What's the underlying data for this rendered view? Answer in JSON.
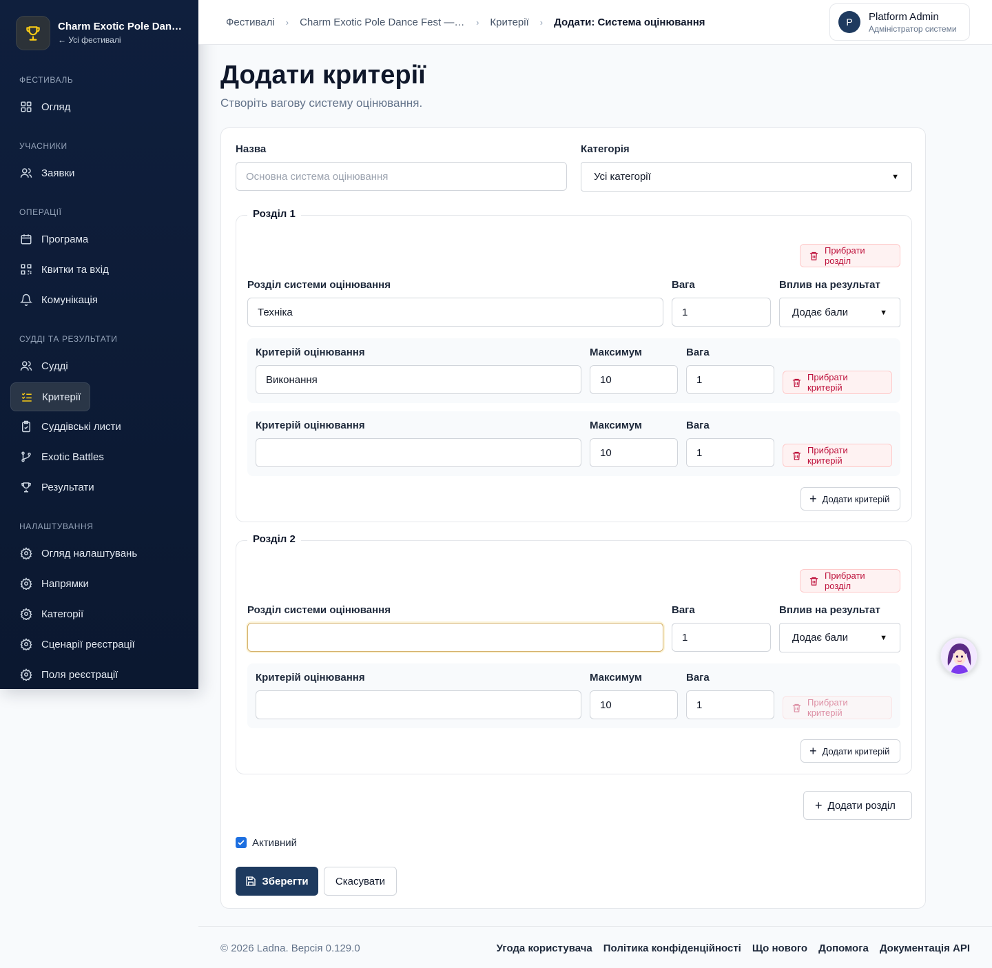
{
  "sidebar": {
    "brand_title": "Charm Exotic Pole Dance...",
    "brand_sub": "← Усі фестивалі",
    "sections": {
      "festival": "ФЕСТИВАЛЬ",
      "participants": "УЧАСНИКИ",
      "operations": "ОПЕРАЦІЇ",
      "judges_results": "СУДДІ ТА РЕЗУЛЬТАТИ",
      "settings": "НАЛАШТУВАННЯ"
    },
    "items": {
      "overview": "Огляд",
      "applications": "Заявки",
      "program": "Програма",
      "tickets": "Квитки та вхід",
      "communication": "Комунікація",
      "judges": "Судді",
      "criteria": "Критерії",
      "scoresheets": "Суддівські листи",
      "battles": "Exotic Battles",
      "results": "Результати",
      "settings_overview": "Огляд налаштувань",
      "directions": "Напрямки",
      "categories": "Категорії",
      "reg_scenarios": "Сценарії реєстрації",
      "reg_fields": "Поля реєстрації"
    }
  },
  "breadcrumb": {
    "c1": "Фестивалі",
    "c2": "Charm Exotic Pole Dance Fest — A...",
    "c3": "Критерії",
    "c4": "Додати: Система оцінювання"
  },
  "user": {
    "name": "Platform Admin",
    "role": "Адміністратор системи",
    "initial": "P"
  },
  "page": {
    "title": "Додати критерії",
    "subtitle": "Створіть вагову систему оцінювання."
  },
  "form": {
    "name_label": "Назва",
    "name_placeholder": "Основна система оцінювання",
    "category_label": "Категорія",
    "category_value": "Усі категорії",
    "section_label": "Розділ системи оцінювання",
    "weight_label": "Вага",
    "impact_label": "Вплив на результат",
    "criterion_label": "Критерій оцінювання",
    "max_label": "Максимум",
    "remove_section": "Прибрати розділ",
    "remove_criterion": "Прибрати критерій",
    "add_criterion": "Додати критерій",
    "add_section": "Додати розділ",
    "active_label": "Активний",
    "save": "Зберегти",
    "cancel": "Скасувати"
  },
  "sections": [
    {
      "legend": "Розділ 1",
      "name": "Техніка",
      "weight": "1",
      "impact": "Додає бали",
      "criteria": [
        {
          "name": "Виконання",
          "max": "10",
          "weight": "1"
        },
        {
          "name": "",
          "max": "10",
          "weight": "1"
        }
      ]
    },
    {
      "legend": "Розділ 2",
      "name": "",
      "weight": "1",
      "impact": "Додає бали",
      "criteria": [
        {
          "name": "",
          "max": "10",
          "weight": "1"
        }
      ]
    }
  ],
  "footer": {
    "copyright": "© 2026 Ladna. Версія 0.129.0",
    "links": [
      "Угода користувача",
      "Політика конфіденційності",
      "Що нового",
      "Допомога",
      "Документація API"
    ]
  },
  "colors": {
    "sidebar_bg": "#0f1f3d",
    "primary": "#1e3a5f",
    "accent": "#facc15",
    "danger": "#be123c"
  }
}
